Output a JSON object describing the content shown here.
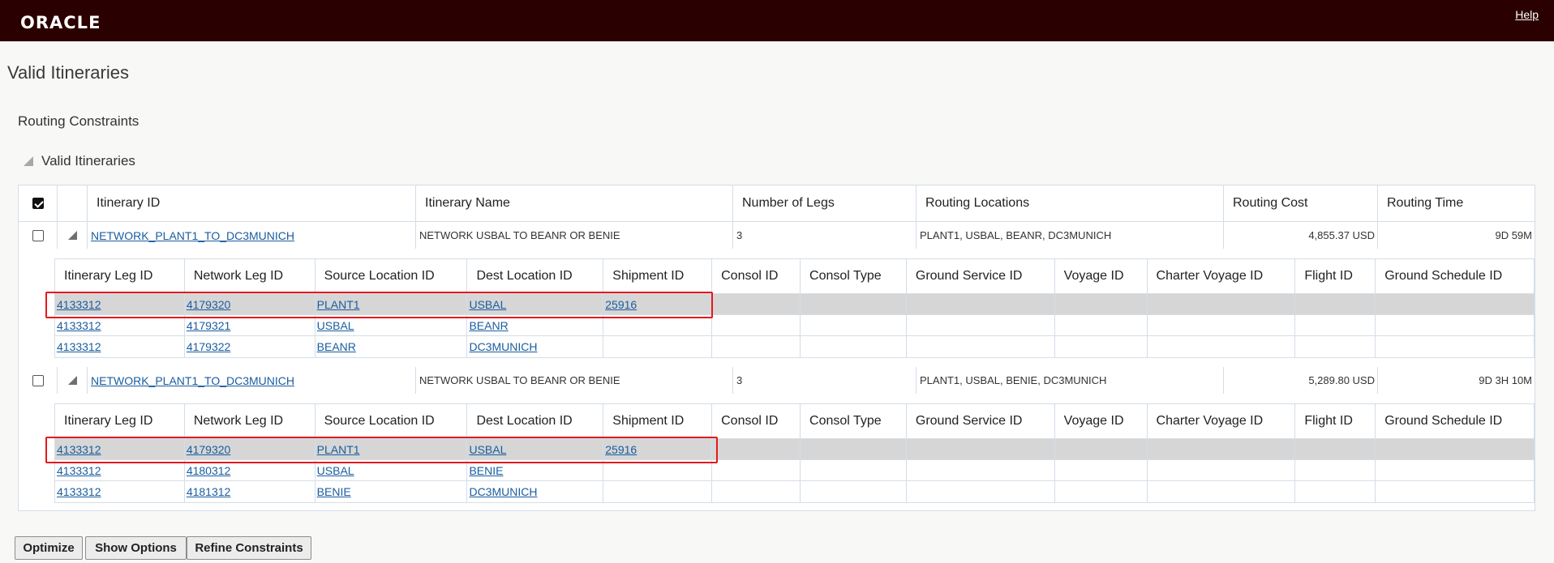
{
  "header": {
    "logo": "ORACLE",
    "help": "Help"
  },
  "page_title": "Valid Itineraries",
  "section_title": "Routing Constraints",
  "subsection_title": "Valid Itineraries",
  "columns": {
    "itinerary_id": "Itinerary ID",
    "itinerary_name": "Itinerary Name",
    "number_of_legs": "Number of Legs",
    "routing_locations": "Routing Locations",
    "routing_cost": "Routing Cost",
    "routing_time": "Routing Time"
  },
  "detail_columns": {
    "leg_id": "Itinerary Leg ID",
    "network_leg_id": "Network Leg ID",
    "source": "Source Location ID",
    "dest": "Dest Location ID",
    "shipment": "Shipment ID",
    "consol_id": "Consol ID",
    "consol_type": "Consol Type",
    "ground_service": "Ground Service ID",
    "voyage": "Voyage ID",
    "charter_voyage": "Charter Voyage ID",
    "flight": "Flight ID",
    "ground_schedule": "Ground Schedule ID"
  },
  "itineraries": [
    {
      "id": "NETWORK_PLANT1_TO_DC3MUNICH",
      "name": "NETWORK USBAL TO BEANR OR BENIE",
      "legs": "3",
      "locations": "PLANT1, USBAL, BEANR, DC3MUNICH",
      "cost": "4,855.37 USD",
      "time": "9D 59M",
      "detail": [
        {
          "leg_id": "4133312",
          "network_leg_id": "4179320",
          "source": "PLANT1",
          "dest": "USBAL",
          "shipment": "25916"
        },
        {
          "leg_id": "4133312",
          "network_leg_id": "4179321",
          "source": "USBAL",
          "dest": "BEANR",
          "shipment": ""
        },
        {
          "leg_id": "4133312",
          "network_leg_id": "4179322",
          "source": "BEANR",
          "dest": "DC3MUNICH",
          "shipment": ""
        }
      ]
    },
    {
      "id": "NETWORK_PLANT1_TO_DC3MUNICH",
      "name": "NETWORK USBAL TO BEANR OR BENIE",
      "legs": "3",
      "locations": "PLANT1, USBAL, BENIE, DC3MUNICH",
      "cost": "5,289.80 USD",
      "time": "9D 3H 10M",
      "detail": [
        {
          "leg_id": "4133312",
          "network_leg_id": "4179320",
          "source": "PLANT1",
          "dest": "USBAL",
          "shipment": "25916"
        },
        {
          "leg_id": "4133312",
          "network_leg_id": "4180312",
          "source": "USBAL",
          "dest": "BENIE",
          "shipment": ""
        },
        {
          "leg_id": "4133312",
          "network_leg_id": "4181312",
          "source": "BENIE",
          "dest": "DC3MUNICH",
          "shipment": ""
        }
      ]
    }
  ],
  "buttons": {
    "optimize": "Optimize",
    "show_options": "Show Options",
    "refine_constraints": "Refine Constraints"
  },
  "colors": {
    "header_bg": "#2b0000",
    "link": "#1a5da0",
    "highlight_border": "#e4191c",
    "selected_row": "#d6d6d6"
  }
}
